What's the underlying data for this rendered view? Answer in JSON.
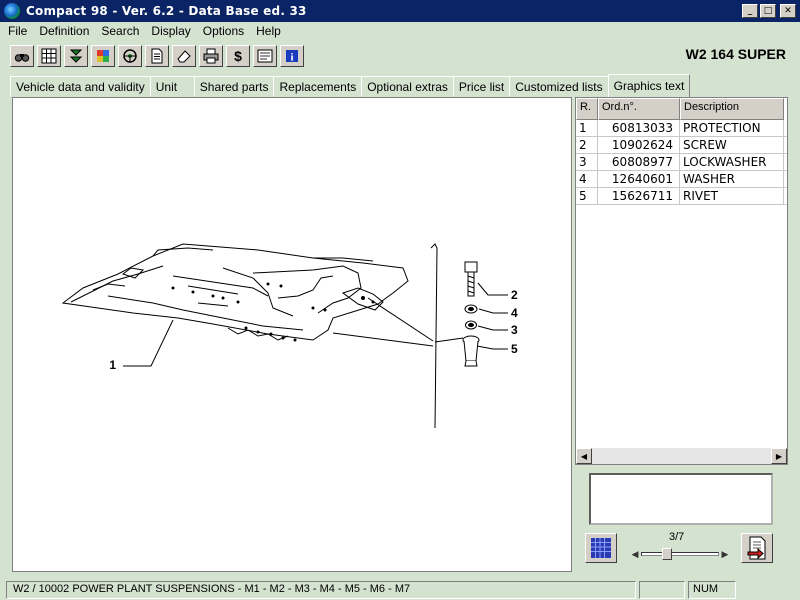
{
  "window": {
    "title": "Compact 98  -  Ver. 6.2  -  Data Base ed. 33",
    "controls": [
      "_",
      "□",
      "✕"
    ]
  },
  "menu": [
    "File",
    "Definition",
    "Search",
    "Display",
    "Options",
    "Help"
  ],
  "toolbar": {
    "icons": [
      "binoculars-icon",
      "grid-icon",
      "filter-icon",
      "puzzle-icon",
      "steering-wheel-icon",
      "document-icon",
      "eraser-icon",
      "printer-icon",
      "dollar-icon",
      "image-icon",
      "info-icon"
    ],
    "vehicle_name": "W2 164 SUPER"
  },
  "tabs": [
    {
      "label": "Vehicle data and validity"
    },
    {
      "label": "Unit"
    },
    {
      "label": "Shared parts"
    },
    {
      "label": "Replacements"
    },
    {
      "label": "Optional extras"
    },
    {
      "label": "Price list"
    },
    {
      "label": "Customized lists"
    },
    {
      "label": "Graphics text",
      "active": true
    }
  ],
  "drawing": {
    "callouts": [
      "1",
      "2",
      "4",
      "3",
      "5"
    ]
  },
  "parts_table": {
    "headers": {
      "ref": "R.",
      "order": "Ord.n°.",
      "description": "Description"
    },
    "rows": [
      {
        "ref": "1",
        "order": "60813033",
        "description": "PROTECTION"
      },
      {
        "ref": "2",
        "order": "10902624",
        "description": "SCREW"
      },
      {
        "ref": "3",
        "order": "60808977",
        "description": "LOCKWASHER"
      },
      {
        "ref": "4",
        "order": "12640601",
        "description": "WASHER"
      },
      {
        "ref": "5",
        "order": "15626711",
        "description": "RIVET"
      }
    ]
  },
  "navigation": {
    "page_counter": "3/7",
    "slider_position": 0.33
  },
  "status": {
    "main": "W2 / 10002  POWER PLANT SUSPENSIONS  - M1 - M2 - M3 - M4 - M5 - M6 - M7",
    "num": "NUM"
  }
}
